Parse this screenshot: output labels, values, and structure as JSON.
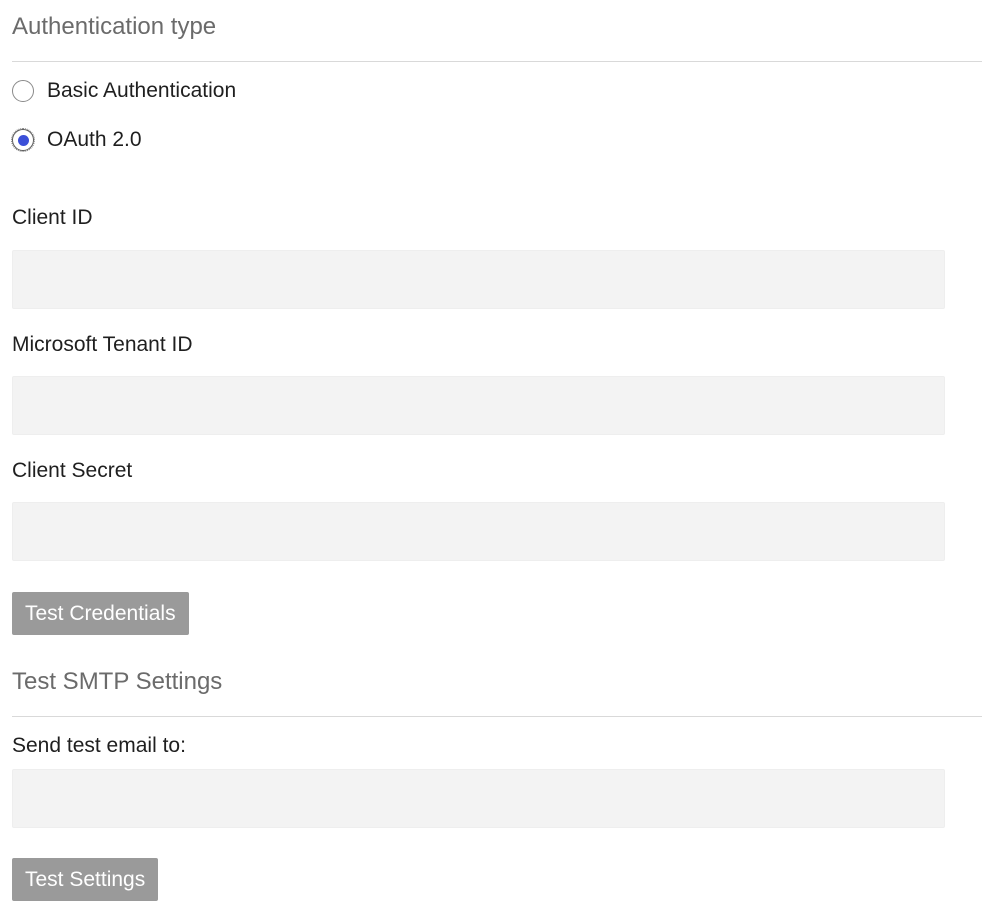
{
  "auth_section": {
    "title": "Authentication type",
    "options": [
      {
        "label": "Basic Authentication",
        "checked": false
      },
      {
        "label": "OAuth 2.0",
        "checked": true
      }
    ]
  },
  "fields": {
    "client_id": {
      "label": "Client ID",
      "value": "",
      "placeholder": ""
    },
    "tenant_id": {
      "label": "Microsoft Tenant ID",
      "value": "",
      "placeholder": ""
    },
    "client_secret": {
      "label": "Client Secret",
      "value": "",
      "placeholder": ""
    }
  },
  "buttons": {
    "test_credentials": "Test Credentials",
    "test_settings": "Test Settings"
  },
  "smtp_section": {
    "title": "Test SMTP Settings",
    "email_label": "Send test email to:",
    "email_value": "",
    "email_placeholder": ""
  },
  "colors": {
    "radio_selected": "#3b4fd8",
    "button_bg": "#9a9a9a",
    "input_bg": "#f3f3f3",
    "section_title": "#6b6b6b"
  }
}
